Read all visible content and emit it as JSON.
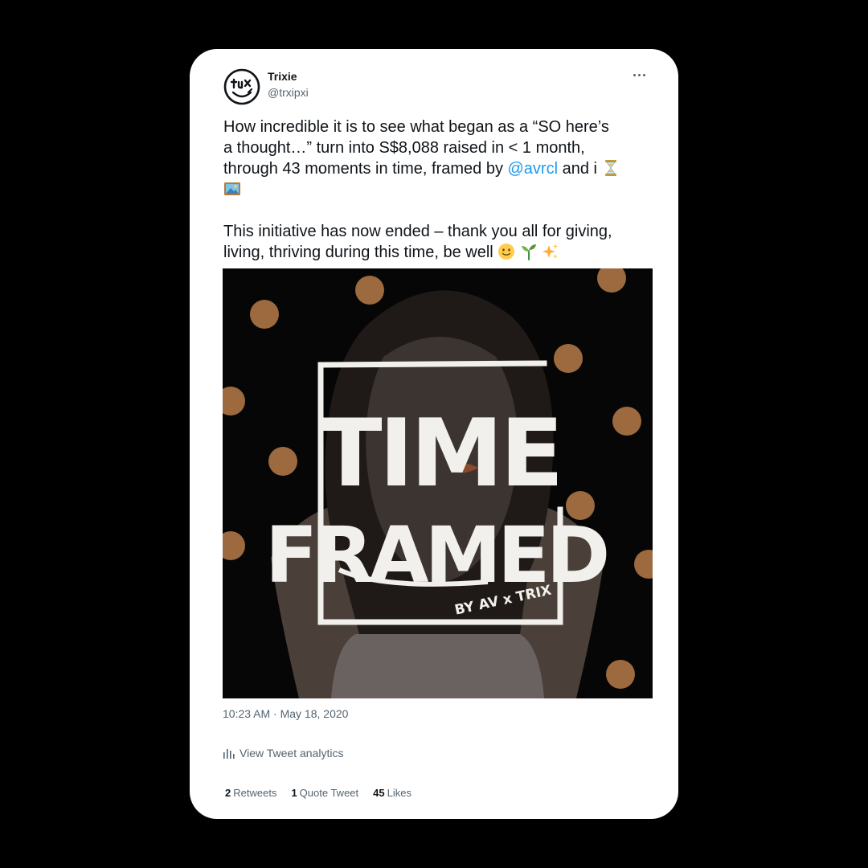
{
  "tweet": {
    "author_name": "Trixie",
    "author_handle": "@trxipxi",
    "text_line1_a": "How incredible it is to see what began as a “SO here’s",
    "text_line2": "a thought…” turn into S$8,088 raised in < 1 month,",
    "text_line3_a": "through 43 moments in time, framed by ",
    "mention": "@avrcl",
    "text_line3_b": " and i",
    "text_para2_line1": "This initiative has now ended – thank you all for giving,",
    "text_para2_line2": "living, thriving during this time, be well",
    "emojis": [
      "hourglass-emoji",
      "framed-picture-emoji",
      "smiling-face-emoji",
      "seedling-emoji",
      "sparkles-emoji"
    ],
    "timestamp": "10:23 AM · May 18, 2020"
  },
  "media": {
    "title_line1": "TIME",
    "title_line2": "FRAMED",
    "byline": "BY AV x TRIX",
    "dot_color": "#9c6a3e",
    "background_color": "#060606"
  },
  "analytics": {
    "label": "View Tweet analytics",
    "icon": "bar-chart-icon"
  },
  "stats": {
    "retweets_count": "2",
    "retweets_label": "Retweets",
    "quotes_count": "1",
    "quotes_label": "Quote Tweet",
    "likes_count": "45",
    "likes_label": "Likes"
  },
  "colors": {
    "link": "#1d9bf0",
    "text": "#0f1419",
    "secondary": "#536471"
  }
}
